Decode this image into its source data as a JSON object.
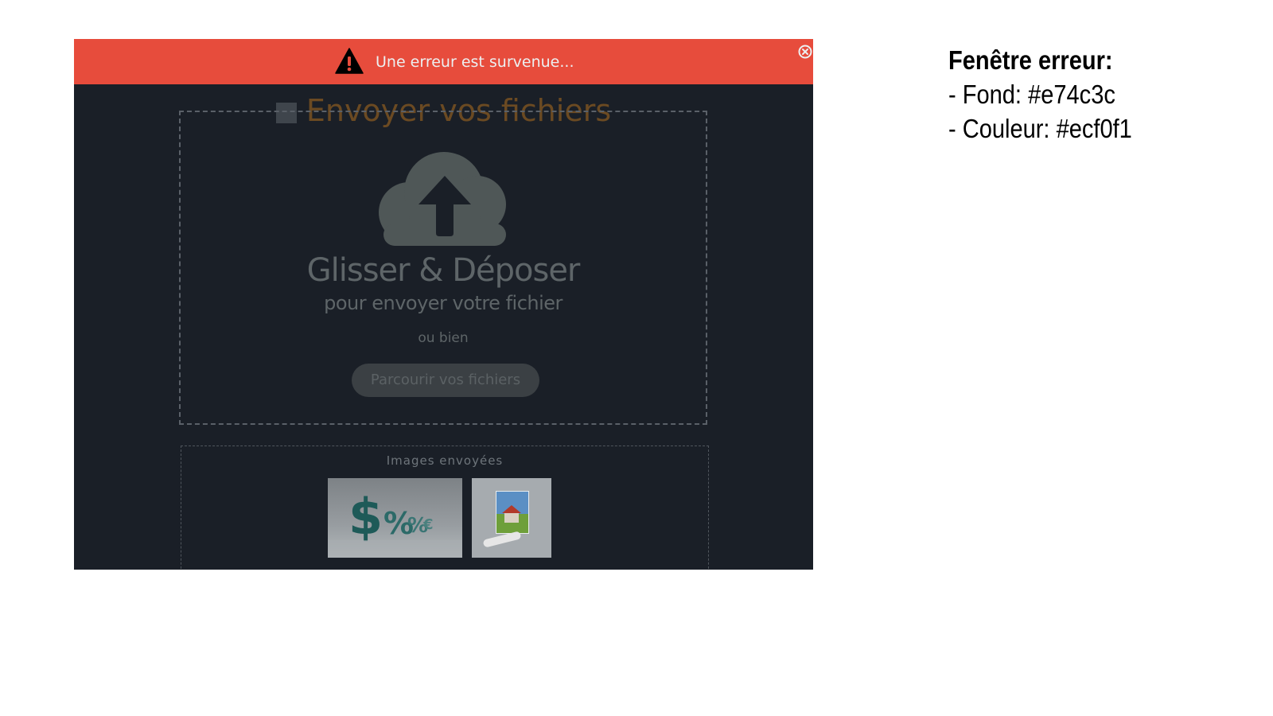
{
  "error_bar": {
    "message": "Une erreur est survenue...",
    "background": "#e74c3c",
    "text_color": "#ecf0f1",
    "icons": [
      "warning-icon",
      "close-icon"
    ]
  },
  "page": {
    "heading": "Envoyer vos fichiers"
  },
  "drop_zone": {
    "title": "Glisser & Déposer",
    "subtitle": "pour envoyer votre fichier",
    "or_text": "ou bien",
    "browse_label": "Parcourir vos fichiers",
    "icon": "cloud-upload-icon"
  },
  "sent_images": {
    "title": "Images envoyées",
    "count": 2
  },
  "annotation": {
    "title": "Fenêtre erreur:",
    "line1": "- Fond: #e74c3c",
    "line2": "- Couleur: #ecf0f1"
  },
  "colors": {
    "app_background": "#1a1f27",
    "muted_text": "#5e6568",
    "heading_accent": "#6b4a22"
  }
}
